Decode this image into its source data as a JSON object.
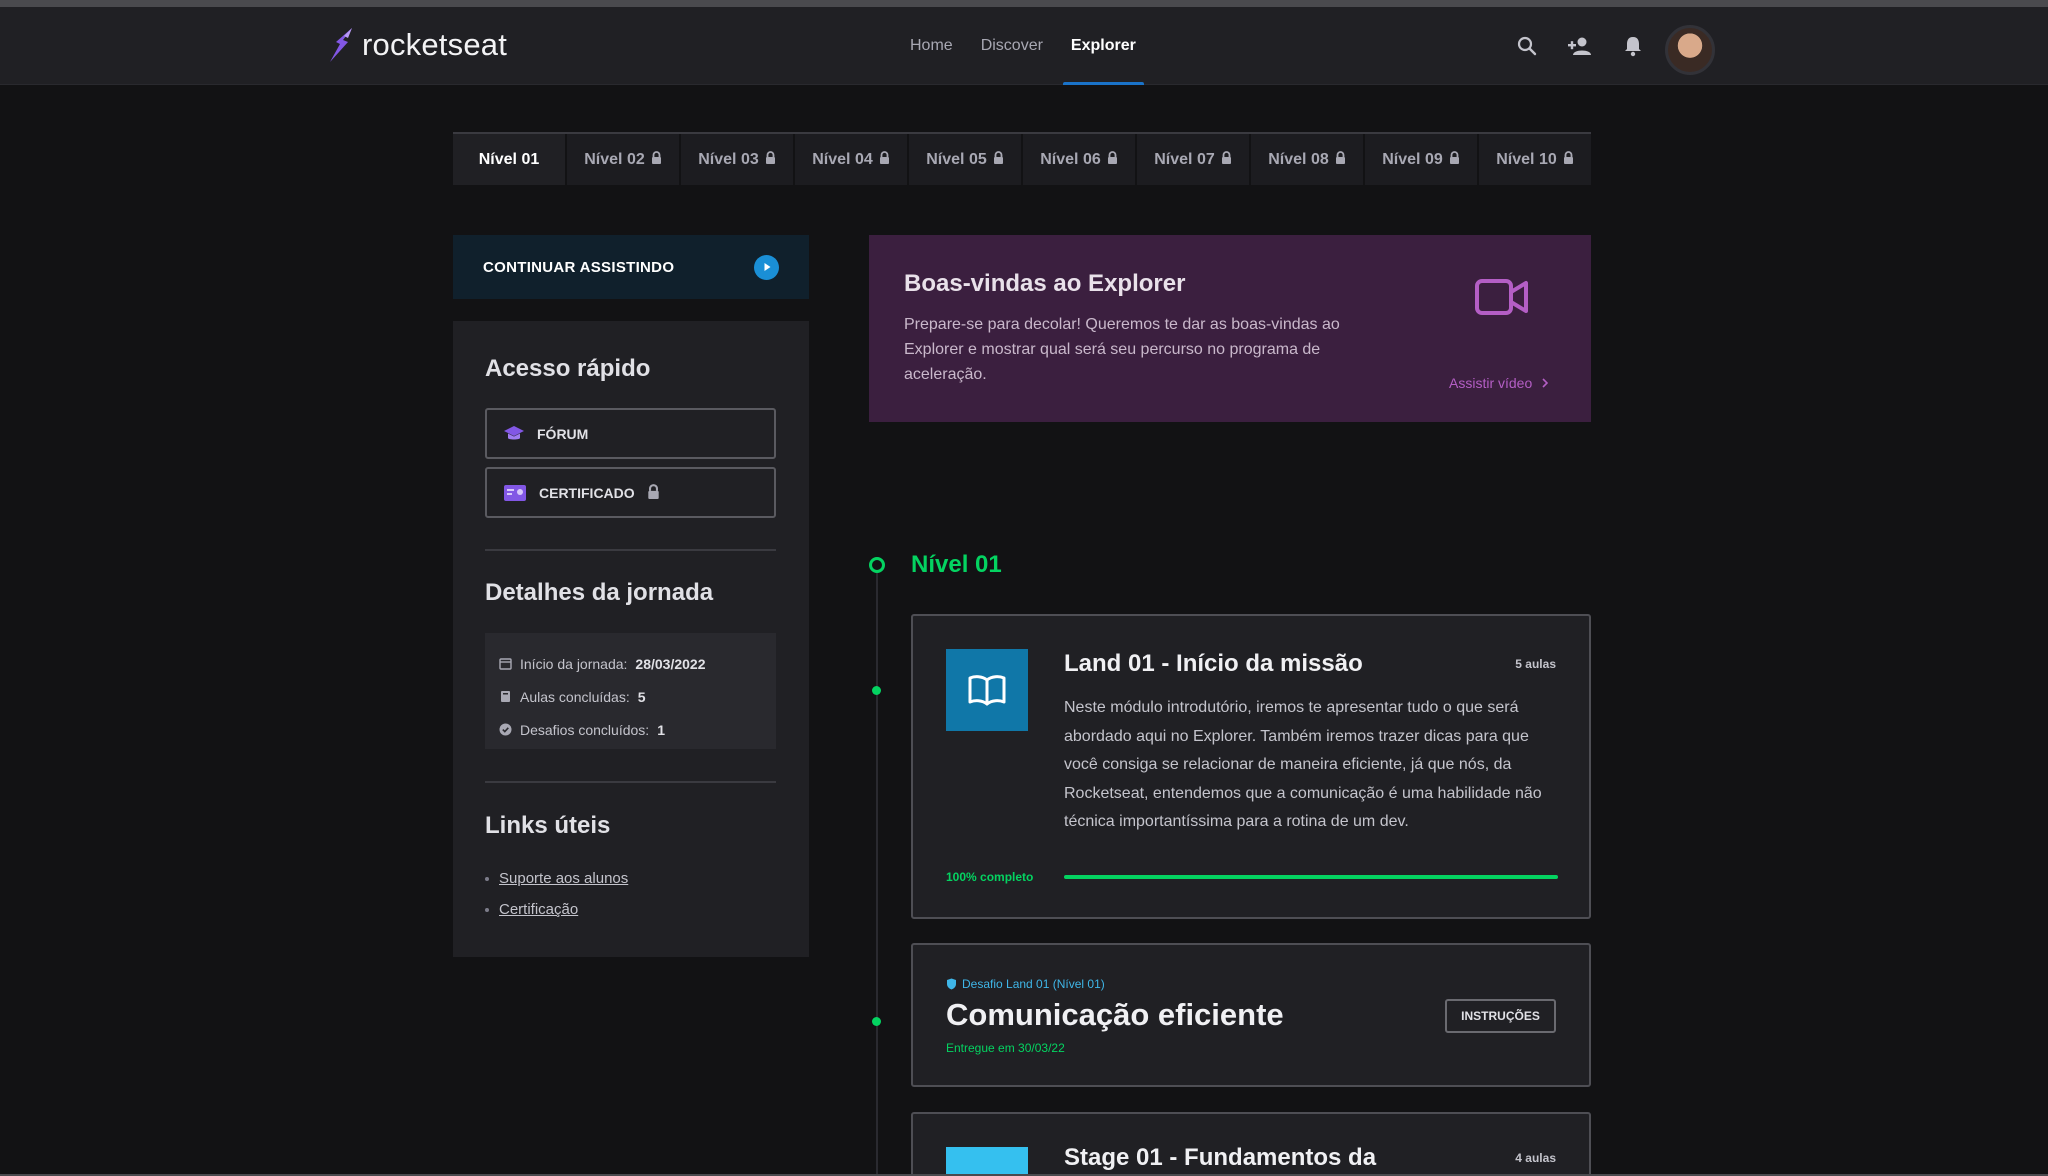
{
  "app": {
    "logo_text": "rocketseat"
  },
  "nav": {
    "items": [
      "Home",
      "Discover",
      "Explorer"
    ],
    "active": "Explorer"
  },
  "header_icons": [
    "search-icon",
    "add-user-icon",
    "bell-icon"
  ],
  "levels": {
    "tabs": [
      "Nível 01",
      "Nível 02",
      "Nível 03",
      "Nível 04",
      "Nível 05",
      "Nível 06",
      "Nível 07",
      "Nível 08",
      "Nível 09",
      "Nível 10"
    ],
    "active_index": 0
  },
  "continue": {
    "label": "CONTINUAR ASSISTINDO"
  },
  "quick_access": {
    "title": "Acesso rápido",
    "forum_label": "FÓRUM",
    "certificate_label": "CERTIFICADO"
  },
  "journey": {
    "title": "Detalhes da jornada",
    "start_label": "Início da jornada:",
    "start_value": "28/03/2022",
    "classes_label": "Aulas concluídas:",
    "classes_value": "5",
    "challenges_label": "Desafios concluídos:",
    "challenges_value": "1"
  },
  "links": {
    "title": "Links úteis",
    "items": [
      "Suporte aos alunos",
      "Certificação"
    ]
  },
  "welcome": {
    "title": "Boas-vindas ao Explorer",
    "text": "Prepare-se para decolar! Queremos te dar as boas-vindas ao Explorer e mostrar qual será seu percurso no programa de aceleração.",
    "link": "Assistir vídeo"
  },
  "timeline": {
    "level_title": "Nível 01",
    "land": {
      "title": "Land 01 - Início da missão",
      "count": "5 aulas",
      "description": "Neste módulo introdutório, iremos te apresentar tudo o que será abordado aqui no Explorer. Também iremos trazer dicas para que você consiga se relacionar de maneira eficiente, já que nós, da Rocketseat, entendemos que a comunicação é uma habilidade não técnica importantíssima para a rotina de um dev.",
      "progress_label": "100% completo",
      "progress": 1.0
    },
    "challenge": {
      "tag": "Desafio Land 01 (Nível 01)",
      "title": "Comunicação eficiente",
      "delivered": "Entregue em 30/03/22",
      "button": "INSTRUÇÕES"
    },
    "stage": {
      "title": "Stage 01 - Fundamentos da",
      "count": "4 aulas"
    }
  },
  "colors": {
    "accent_green": "#04d361",
    "accent_blue": "#1a8fd6",
    "purple": "#8257e5"
  }
}
